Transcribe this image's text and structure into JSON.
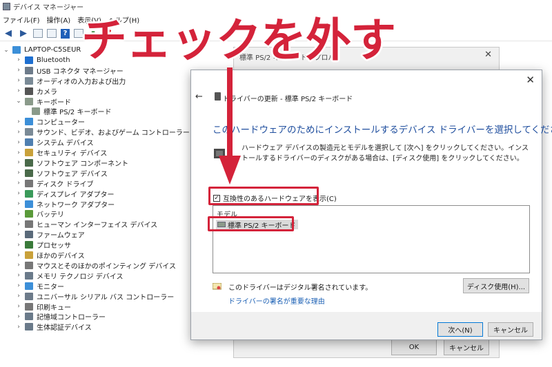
{
  "window": {
    "title": "デバイス マネージャー"
  },
  "menu": [
    "ファイル(F)",
    "操作(A)",
    "表示(V)",
    "ヘルプ(H)"
  ],
  "tree": {
    "root": "LAPTOP-C5SEUR",
    "items": [
      {
        "label": "Bluetooth",
        "icon": "bluetooth-icon",
        "color": "#1e6fd0",
        "expanded": false
      },
      {
        "label": "USB コネクタ マネージャー",
        "icon": "usb-icon",
        "color": "#6d7b8a",
        "expanded": false
      },
      {
        "label": "オーディオの入力および出力",
        "icon": "speaker-icon",
        "color": "#7a8a96",
        "expanded": false
      },
      {
        "label": "カメラ",
        "icon": "camera-icon",
        "color": "#555555",
        "expanded": false
      },
      {
        "label": "キーボード",
        "icon": "keyboard-icon",
        "color": "#8a9a8a",
        "expanded": true
      },
      {
        "label": "標準 PS/2 キーボード",
        "icon": "keyboard-icon",
        "color": "#8a9a8a",
        "child": true
      },
      {
        "label": "コンピューター",
        "icon": "computer-icon",
        "color": "#3c8fd8",
        "expanded": false
      },
      {
        "label": "サウンド、ビデオ、およびゲーム コントローラー",
        "icon": "sound-icon",
        "color": "#7a8a96",
        "expanded": false
      },
      {
        "label": "システム デバイス",
        "icon": "system-icon",
        "color": "#4f7fb0",
        "expanded": false
      },
      {
        "label": "セキュリティ デバイス",
        "icon": "security-icon",
        "color": "#c9a13a",
        "expanded": false
      },
      {
        "label": "ソフトウェア コンポーネント",
        "icon": "component-icon",
        "color": "#4a6a4a",
        "expanded": false
      },
      {
        "label": "ソフトウェア デバイス",
        "icon": "software-device-icon",
        "color": "#4a6a4a",
        "expanded": false
      },
      {
        "label": "ディスク ドライブ",
        "icon": "disk-icon",
        "color": "#777777",
        "expanded": false
      },
      {
        "label": "ディスプレイ アダプター",
        "icon": "display-icon",
        "color": "#3a9a5a",
        "expanded": false
      },
      {
        "label": "ネットワーク アダプター",
        "icon": "network-icon",
        "color": "#3c8fd8",
        "expanded": false
      },
      {
        "label": "バッテリ",
        "icon": "battery-icon",
        "color": "#5a9a3a",
        "expanded": false
      },
      {
        "label": "ヒューマン インターフェイス デバイス",
        "icon": "hid-icon",
        "color": "#777777",
        "expanded": false
      },
      {
        "label": "ファームウェア",
        "icon": "firmware-icon",
        "color": "#5a6a7a",
        "expanded": false
      },
      {
        "label": "プロセッサ",
        "icon": "processor-icon",
        "color": "#3a7a3a",
        "expanded": false
      },
      {
        "label": "ほかのデバイス",
        "icon": "other-device-icon",
        "color": "#c9a13a",
        "expanded": false
      },
      {
        "label": "マウスとそのほかのポインティング デバイス",
        "icon": "mouse-icon",
        "color": "#777777",
        "expanded": false
      },
      {
        "label": "メモリ テクノロジ デバイス",
        "icon": "memory-icon",
        "color": "#6a7a8a",
        "expanded": false
      },
      {
        "label": "モニター",
        "icon": "monitor-icon",
        "color": "#3c8fd8",
        "expanded": false
      },
      {
        "label": "ユニバーサル シリアル バス コントローラー",
        "icon": "usb-controller-icon",
        "color": "#6d7b8a",
        "expanded": false
      },
      {
        "label": "印刷キュー",
        "icon": "printer-icon",
        "color": "#777777",
        "expanded": false
      },
      {
        "label": "記憶域コントローラー",
        "icon": "storage-icon",
        "color": "#6a7a8a",
        "expanded": false
      },
      {
        "label": "生体認証デバイス",
        "icon": "biometric-icon",
        "color": "#6a7a8a",
        "expanded": false
      }
    ]
  },
  "bg_dialog": {
    "title": "標準 PS/2 キーボードのプロパ",
    "ok": "OK",
    "cancel": "キャンセル"
  },
  "dialog": {
    "title": "ドライバーの更新 - 標準 PS/2 キーボード",
    "heading": "このハードウェアのためにインストールするデバイス ドライバーを選択してください。",
    "description": "ハードウェア デバイスの製造元とモデルを選択して [次へ] をクリックしてください。インストールするドライバーのディスクがある場合は、[ディスク使用] をクリックしてください。",
    "compat_label": "互換性のあるハードウェアを表示(C)",
    "compat_checked": true,
    "model_header": "モデル",
    "models": [
      "標準 PS/2 キーボード"
    ],
    "signed_text": "このドライバーはデジタル署名されています。",
    "signing_link": "ドライバーの署名が重要な理由",
    "disk_button": "ディスク使用(H)...",
    "next_button": "次へ(N)",
    "cancel_button": "キャンセル"
  },
  "annotation": {
    "text": "チェックを外す",
    "color": "#d4233a"
  }
}
